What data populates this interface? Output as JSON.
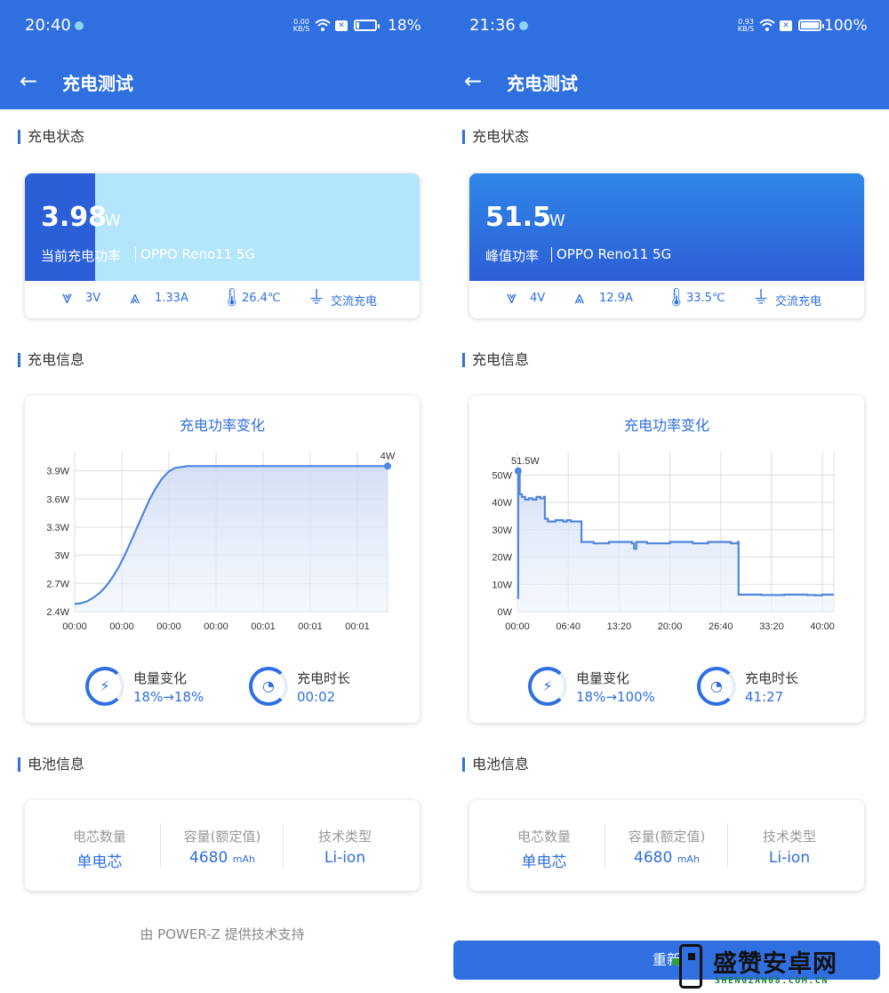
{
  "screens": [
    {
      "status": {
        "time": "20:40",
        "net_speed": "0.00",
        "net_unit": "KB/S",
        "battery_pct": "18%",
        "battery_level": 0.18
      },
      "header": {
        "title": "充电测试"
      },
      "sections": {
        "status": "充电状态",
        "info": "充电信息",
        "battery": "电池信息"
      },
      "power": {
        "value": "3.98",
        "unit": "W",
        "label": "当前充电功率",
        "device": "OPPO Reno11 5G",
        "level_fraction": 0.18
      },
      "metrics": {
        "voltage": "3V",
        "current": "1.33A",
        "temperature": "26.4℃",
        "mode": "交流充电"
      },
      "chart_title": "充电功率变化",
      "chart_data": {
        "type": "area",
        "title": "充电功率变化",
        "y_ticks": [
          "2.4W",
          "2.7W",
          "3W",
          "3.3W",
          "3.6W",
          "3.9W"
        ],
        "x_ticks": [
          "00:00",
          "00:00",
          "00:00",
          "00:00",
          "00:01",
          "00:01",
          "00:01"
        ],
        "ylim": [
          2.4,
          4.0
        ],
        "peak_label": "4W",
        "x": [
          0,
          0.5,
          1,
          1.5,
          2,
          2.5,
          3,
          3.5,
          4,
          4.5,
          5,
          5.5,
          6,
          6.5,
          7,
          7.5,
          8,
          9,
          10,
          11,
          12,
          13,
          14,
          15,
          16,
          17,
          18,
          19,
          20,
          21,
          22,
          23,
          24,
          25
        ],
        "y": [
          2.48,
          2.49,
          2.51,
          2.55,
          2.6,
          2.67,
          2.76,
          2.87,
          3.0,
          3.15,
          3.3,
          3.45,
          3.6,
          3.72,
          3.82,
          3.89,
          3.93,
          3.95,
          3.95,
          3.95,
          3.95,
          3.95,
          3.95,
          3.95,
          3.95,
          3.95,
          3.95,
          3.95,
          3.95,
          3.95,
          3.95,
          3.95,
          3.95,
          3.95
        ],
        "grid": true
      },
      "stats": {
        "energy_label": "电量变化",
        "energy_value": "18%→18%",
        "duration_label": "充电时长",
        "duration_value": "00:02"
      },
      "battery": {
        "cells_label": "电芯数量",
        "cells_value": "单电芯",
        "capacity_label": "容量(额定值)",
        "capacity_value": "4680",
        "capacity_unit": "mAh",
        "tech_label": "技术类型",
        "tech_value": "Li-ion"
      },
      "footer": "由 POWER-Z 提供技术支持"
    },
    {
      "status": {
        "time": "21:36",
        "net_speed": "0.93",
        "net_unit": "KB/S",
        "battery_pct": "100%",
        "battery_level": 1.0
      },
      "header": {
        "title": "充电测试"
      },
      "sections": {
        "status": "充电状态",
        "info": "充电信息",
        "battery": "电池信息"
      },
      "power": {
        "value": "51.5",
        "unit": "W",
        "label": "峰值功率",
        "device": "OPPO Reno11 5G",
        "level_fraction": 1.0
      },
      "metrics": {
        "voltage": "4V",
        "current": "12.9A",
        "temperature": "33.5℃",
        "mode": "交流充电"
      },
      "chart_title": "充电功率变化",
      "chart_data": {
        "type": "area",
        "title": "充电功率变化",
        "y_ticks": [
          "0W",
          "10W",
          "20W",
          "30W",
          "40W",
          "50W"
        ],
        "x_ticks": [
          "00:00",
          "06:40",
          "13:20",
          "20:00",
          "26:40",
          "33:20",
          "40:00"
        ],
        "ylim": [
          0,
          55
        ],
        "xlim": [
          0,
          41.5
        ],
        "peak_label": "51.5W",
        "x": [
          0,
          0.1,
          0.3,
          0.6,
          1.0,
          1.5,
          2.0,
          2.5,
          3.0,
          3.5,
          3.6,
          4.0,
          5.0,
          6.0,
          6.5,
          7.0,
          8.3,
          8.4,
          10,
          12,
          15,
          15.3,
          15.6,
          17,
          20,
          23,
          25,
          28,
          28.9,
          29.0,
          32,
          35,
          38,
          39,
          40,
          41.5
        ],
        "y": [
          5,
          51.5,
          43,
          42,
          41,
          41.5,
          41,
          42,
          41.5,
          42,
          34,
          33,
          33.5,
          33,
          33.5,
          33,
          33,
          25.5,
          25,
          25.5,
          25,
          23,
          25.5,
          25,
          25.5,
          25,
          25.5,
          25,
          25.5,
          6.2,
          6.1,
          6.2,
          6.1,
          6.0,
          6.2,
          6.2
        ],
        "grid": true
      },
      "stats": {
        "energy_label": "电量变化",
        "energy_value": "18%→100%",
        "duration_label": "充电时长",
        "duration_value": "41:27"
      },
      "battery": {
        "cells_label": "电芯数量",
        "cells_value": "单电芯",
        "capacity_label": "容量(额定值)",
        "capacity_value": "4680",
        "capacity_unit": "mAh",
        "tech_label": "技术类型",
        "tech_value": "Li-ion"
      },
      "restart_label": "重新",
      "watermark": {
        "brand": "盛赞安卓网",
        "domain": "SHENGZAN08.COM.CN"
      }
    }
  ],
  "colors": {
    "accent": "#2f6fe0",
    "band_light": "#b3e5fb",
    "band_dark": "#2b5fd8",
    "watermark_green": "#1a7f37"
  },
  "icons": {
    "back": "arrow-left-icon",
    "voltage": "voltage-icon",
    "current": "current-icon",
    "temperature": "thermometer-icon",
    "mode": "plug-icon",
    "energy": "bolt-icon",
    "duration": "clock-icon"
  }
}
